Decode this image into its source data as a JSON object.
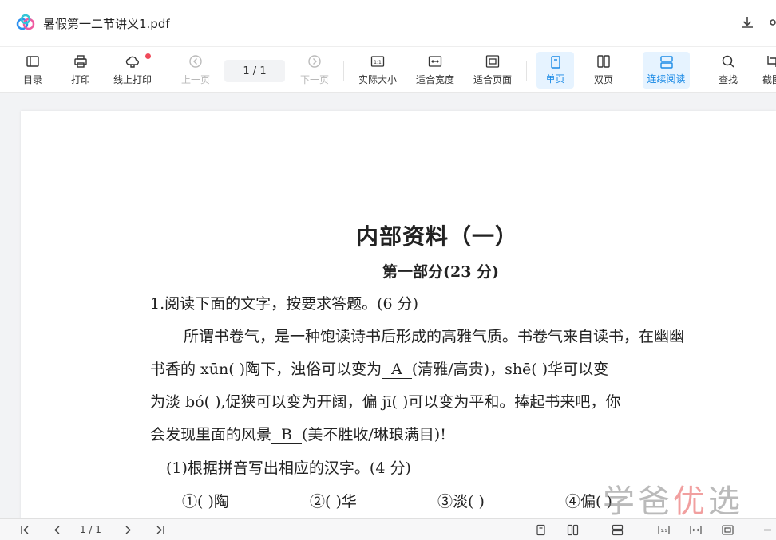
{
  "app": {
    "title": "暑假第一二节讲义1.pdf"
  },
  "toolbar": {
    "toc": "目录",
    "print": "打印",
    "online_print": "线上打印",
    "prev_page": "上一页",
    "page_indicator": "1 / 1",
    "next_page": "下一页",
    "actual_size": "实际大小",
    "fit_width": "适合宽度",
    "fit_page": "适合页面",
    "single_page": "单页",
    "double_page": "双页",
    "continuous": "连续阅读",
    "find": "查找",
    "screenshot": "截图"
  },
  "document": {
    "title": "内部资料（一）",
    "subtitle": "第一部分(23 分)",
    "q1": "1.阅读下面的文字，按要求答题。(6 分)",
    "p1": "所谓书卷气，是一种饱读诗书后形成的高雅气质。书卷气来自读书，在幽幽",
    "p2a": "书香的 xūn(     )陶下，浊俗可以变为",
    "blank_a": "A",
    "p2b": "(清雅/高贵)，shē(     )华可以变",
    "p3": "为淡 bó(     ),促狭可以变为开阔，偏 jī(     )可以变为平和。捧起书来吧，你",
    "p4a": "会发现里面的风景",
    "blank_b": "B",
    "p4b": "(美不胜收/琳琅满目)!",
    "sub_q": "(1)根据拼音写出相应的汉字。(4 分)",
    "opt1": "①(     )陶",
    "opt2": "②(     )华",
    "opt3": "③淡(     )",
    "opt4": "④偏(     )"
  },
  "watermark": {
    "text_a": "学爸",
    "text_b": "优",
    "text_c": "选"
  },
  "statusbar": {
    "page_indicator": "1 / 1"
  },
  "colors": {
    "accent": "#1a8ae6",
    "active_bg": "#e6f3ff",
    "badge": "#f04a5a"
  }
}
